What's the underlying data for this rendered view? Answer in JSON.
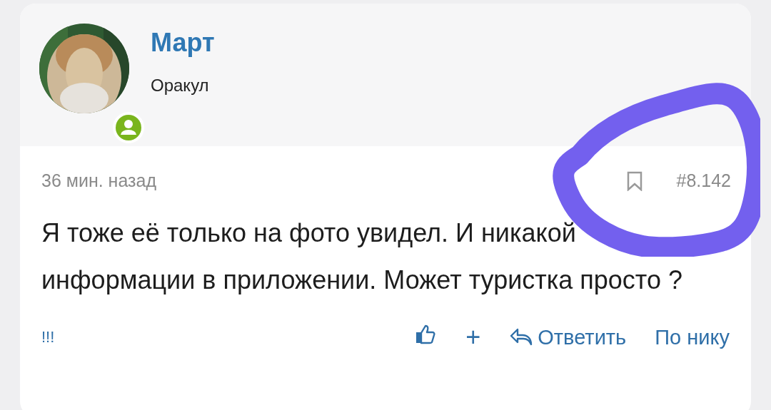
{
  "author": {
    "name": "Март",
    "rank": "Оракул"
  },
  "post": {
    "time": "36 мин. назад",
    "number": "#8.142",
    "text": "Я тоже её только на фото увидел. И никакой информации в приложении. Может туристка просто ?"
  },
  "footer": {
    "signature": "!!!",
    "actions": [
      {
        "kind": "like"
      },
      {
        "kind": "plus",
        "label": "+"
      },
      {
        "kind": "reply",
        "label": "Ответить"
      },
      {
        "kind": "text",
        "label": "По нику"
      }
    ]
  }
}
